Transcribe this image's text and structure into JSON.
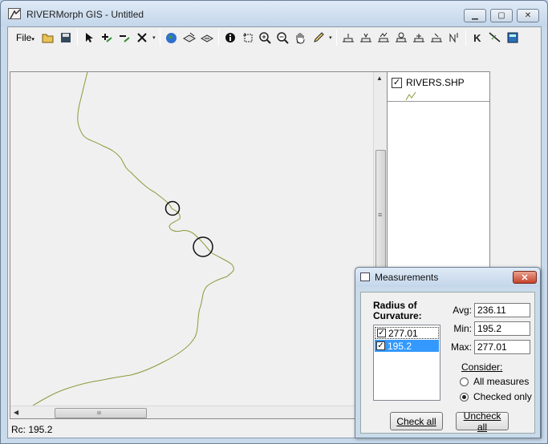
{
  "window": {
    "title": "RIVERMorph GIS - Untitled",
    "minimize_glyph": "▁",
    "maximize_glyph": "▢",
    "close_glyph": "✕"
  },
  "toolbar": {
    "file_label": "File",
    "icons": [
      "open-folder-icon",
      "save-icon",
      "pointer-icon",
      "add-vertex-icon",
      "remove-vertex-icon",
      "delete-icon",
      "globe-icon",
      "layer-stack-icon",
      "layer-swap-icon",
      "info-icon",
      "select-rect-icon",
      "zoom-in-icon",
      "zoom-out-icon",
      "pan-hand-icon",
      "pencil-icon",
      "profile-tool-1-icon",
      "profile-tool-2-icon",
      "profile-tool-3-icon",
      "profile-tool-4-icon",
      "profile-tool-5-icon",
      "profile-tool-6-icon",
      "north-arrow-icon",
      "k-icon",
      "measure-icon",
      "calculator-icon"
    ]
  },
  "layers": {
    "items": [
      {
        "name": "RIVERS.SHP",
        "checked": true
      }
    ]
  },
  "status": {
    "text": "Rc:  195.2"
  },
  "measurements": {
    "title": "Measurements",
    "close_glyph": "✕",
    "roc_label": "Radius of Curvature:",
    "roc_items": [
      {
        "value": "277.01",
        "checked": true,
        "selected": false
      },
      {
        "value": "195.2",
        "checked": true,
        "selected": true
      }
    ],
    "avg_label": "Avg:",
    "avg_value": "236.11",
    "min_label": "Min:",
    "min_value": "195.2",
    "max_label": "Max:",
    "max_value": "277.01",
    "consider_label": "Consider:",
    "option_all": "All measures",
    "option_checked": "Checked only",
    "selected_option": "Checked only",
    "check_all_label": "Check all",
    "uncheck_all_label": "Uncheck all"
  },
  "colors": {
    "river_line": "#8a9a3a",
    "selection": "#3399ff",
    "close_button": "#c7432a"
  }
}
